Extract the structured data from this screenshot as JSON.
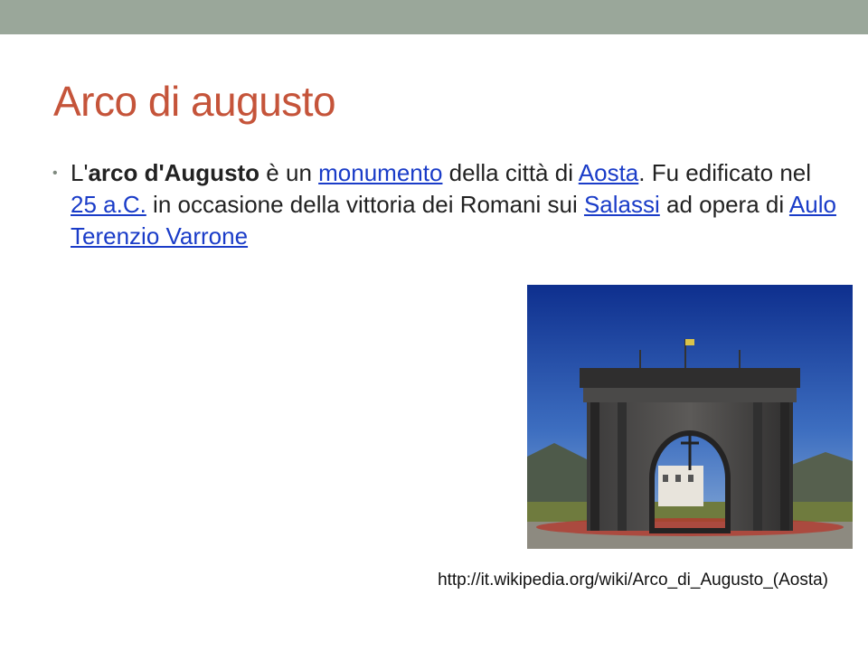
{
  "slide": {
    "title": "Arco di augusto",
    "bullet": {
      "t1": "L'",
      "t2": "arco d'Augusto",
      "t3": " è un ",
      "link1": "monumento",
      "t4": " della città di ",
      "link2": "Aosta",
      "t5": ". Fu edificato nel ",
      "link3": "25 a.C.",
      "t6": " in occasione della vittoria dei Romani sui ",
      "link4": "Salassi",
      "t7": " ad opera di ",
      "link5": "Aulo Terenzio Varrone"
    },
    "source_url": "http://it.wikipedia.org/wiki/Arco_di_Augusto_(Aosta)"
  },
  "colors": {
    "topbar": "#9aa79a",
    "title": "#c5543a",
    "link": "#1a3cc8",
    "bullet_dot": "#7f8a7f"
  }
}
